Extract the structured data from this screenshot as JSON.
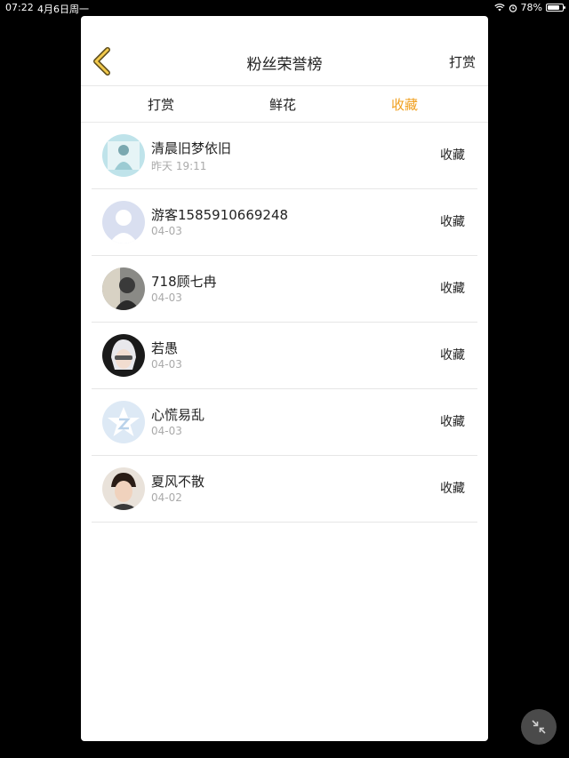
{
  "status_bar": {
    "time": "07:22",
    "date": "4月6日周一",
    "battery": "78%",
    "battery_level": 0.78
  },
  "header": {
    "title": "粉丝荣誉榜",
    "right_action": "打赏",
    "back_icon": "chevron-left-icon"
  },
  "tabs": [
    {
      "label": "打赏",
      "active": false
    },
    {
      "label": "鲜花",
      "active": false
    },
    {
      "label": "收藏",
      "active": true
    }
  ],
  "accent_color": "#f0a020",
  "fans": [
    {
      "name": "清晨旧梦依旧",
      "time": "昨天 19:11",
      "action": "收藏",
      "avatar": "photo-avatar-girl"
    },
    {
      "name": "游客1585910669248",
      "time": "04-03",
      "action": "收藏",
      "avatar": "default-user-avatar"
    },
    {
      "name": "718顾七冉",
      "time": "04-03",
      "action": "收藏",
      "avatar": "photo-avatar-dark"
    },
    {
      "name": "若愚",
      "time": "04-03",
      "action": "收藏",
      "avatar": "photo-avatar-silver-hair"
    },
    {
      "name": "心慌易乱",
      "time": "04-03",
      "action": "收藏",
      "avatar": "qq-star-avatar"
    },
    {
      "name": "夏风不散",
      "time": "04-02",
      "action": "收藏",
      "avatar": "photo-avatar-boy"
    }
  ]
}
